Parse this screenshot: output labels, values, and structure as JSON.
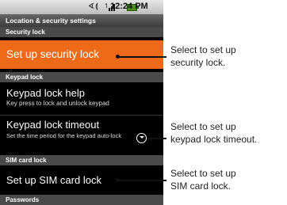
{
  "status_bar": {
    "icons": [
      "vibrate-icon",
      "wifi-icon",
      "signal-icon",
      "battery-icon"
    ],
    "time": "12:24 PM"
  },
  "title": "Location & security settings",
  "sections": {
    "security_lock": "Security lock",
    "keypad_lock": "Keypad lock",
    "sim_card_lock": "SIM card lock",
    "passwords": "Passwords"
  },
  "items": {
    "set_up_security_lock": "Set up security lock",
    "keypad_lock_help": {
      "title": "Keypad lock help",
      "summary": "Key press to lock and unlock keypad"
    },
    "keypad_lock_timeout": {
      "title": "Keypad lock timeout",
      "summary": "Set the time period for the keypad auto-lock"
    },
    "set_up_sim_card_lock": "Set up SIM card lock"
  },
  "callouts": [
    {
      "line1": "Select to set up",
      "line2": "security lock."
    },
    {
      "line1": "Select to set up",
      "line2": "keypad lock timeout."
    },
    {
      "line1": "Select to set up",
      "line2": "SIM card lock."
    }
  ],
  "colors": {
    "selected_item": "#ef6a18",
    "screen_background": "#000000"
  }
}
